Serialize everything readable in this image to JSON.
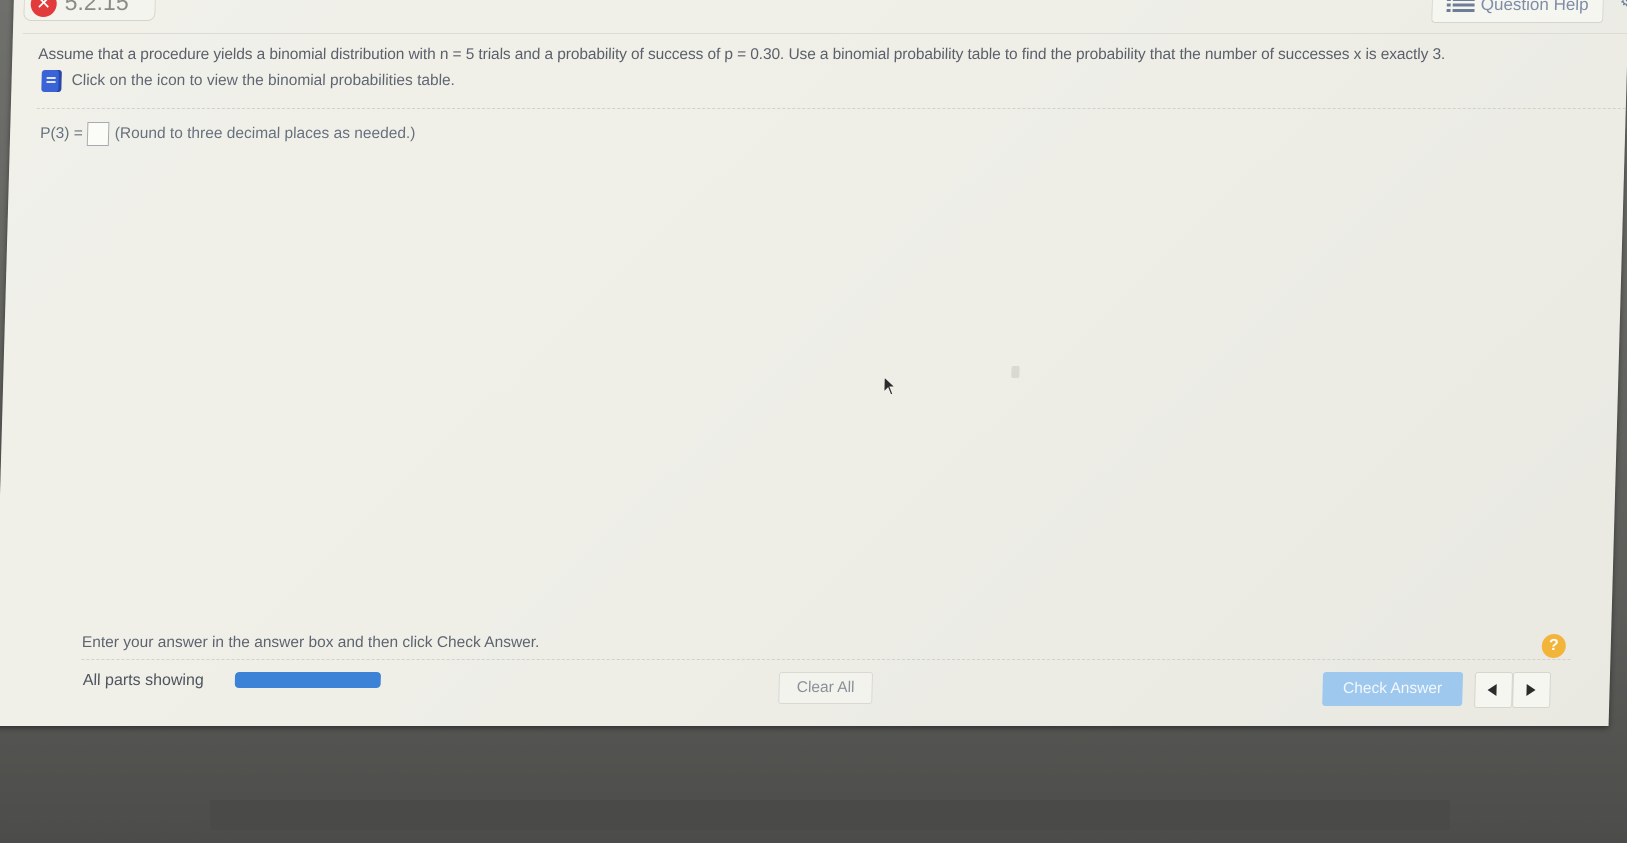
{
  "header": {
    "problem_number": "5.2.15",
    "status_icon": "incorrect-x-icon",
    "question_help_label": "Question Help"
  },
  "question": {
    "text": "Assume that a procedure yields a binomial distribution with n = 5 trials and a probability of success of p = 0.30. Use a binomial probability table to find the probability that the number of successes x is exactly 3.",
    "table_link_text": "Click on the icon to view the binomial probabilities table."
  },
  "answer": {
    "label": "P(3) =",
    "value": "",
    "hint": "(Round to three decimal places as needed.)"
  },
  "footer": {
    "instructions": "Enter your answer in the answer box and then click Check Answer.",
    "parts_label": "All parts showing",
    "progress_fraction": 1.0,
    "clear_all_label": "Clear All",
    "check_answer_label": "Check Answer",
    "help_symbol": "?"
  },
  "colors": {
    "status_red": "#e23b3b",
    "link_blue": "#3a63d6",
    "progress_blue": "#3c82d6",
    "check_button": "#9ec8ee",
    "help_orange": "#f3b43a"
  }
}
